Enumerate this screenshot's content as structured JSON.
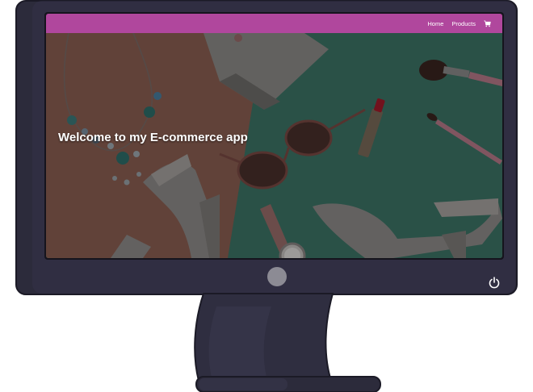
{
  "navbar": {
    "links": [
      "Home",
      "Products"
    ],
    "cart_icon": "shopping-cart-icon",
    "color": "#b0479d"
  },
  "hero": {
    "title": "Welcome to my E-commerce app",
    "image": "fashion-accessories-flat-lay"
  },
  "monitor": {
    "icons": [
      "power-icon",
      "webcam-icon"
    ],
    "frame_color": "#2c2b3b",
    "stand_color": "#2f2e40"
  },
  "colors": {
    "terracotta": "#8c5f52",
    "teal": "#3d7466",
    "overlay": "rgba(0,0,0,0.35)"
  }
}
